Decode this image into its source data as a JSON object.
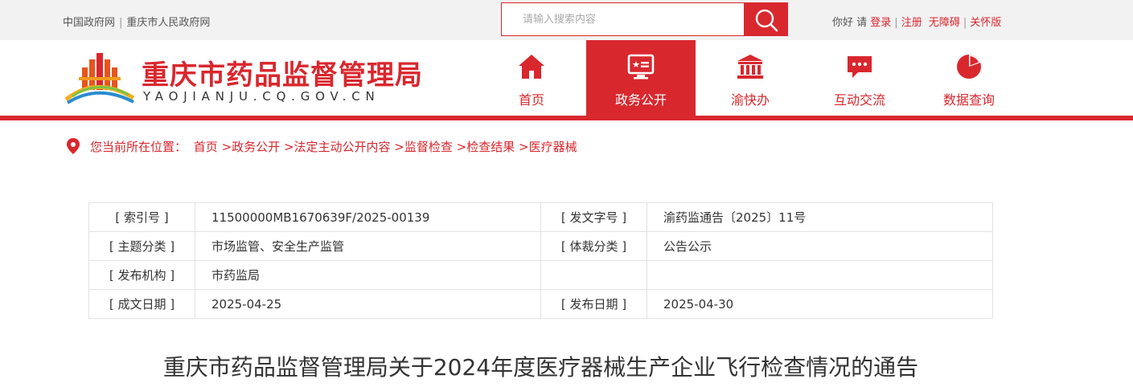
{
  "topbar": {
    "links": [
      "中国政府网",
      "重庆市人民政府网"
    ],
    "search_placeholder": "请输入搜索内容",
    "greeting": "你好 请",
    "login": "登录",
    "register": "注册",
    "accessible": "无障碍",
    "elder_mode": "关怀版"
  },
  "header": {
    "title": "重庆市药品监督管理局",
    "domain": "YAOJIANJU.CQ.GOV.CN",
    "nav": [
      {
        "label": "首页",
        "icon": "home-icon",
        "active": false
      },
      {
        "label": "政务公开",
        "icon": "monitor-star-icon",
        "active": true
      },
      {
        "label": "渝快办",
        "icon": "government-building-icon",
        "active": false
      },
      {
        "label": "互动交流",
        "icon": "chat-icon",
        "active": false
      },
      {
        "label": "数据查询",
        "icon": "pie-chart-icon",
        "active": false
      }
    ]
  },
  "colors": {
    "brand_red": "#d9272e",
    "topbar_bg": "#f2f2f2",
    "border": "#e2e2e2"
  },
  "breadcrumb": {
    "prefix": "您当前所在位置：",
    "items": [
      "首页",
      "政务公开",
      "法定主动公开内容",
      "监督检查",
      "检查结果",
      "医疗器械"
    ]
  },
  "meta": {
    "rows": [
      {
        "k1": "[ 索引号 ]",
        "v1": "11500000MB1670639F/2025-00139",
        "k2": "[ 发文字号 ]",
        "v2": "渝药监通告〔2025〕11号"
      },
      {
        "k1": "[ 主题分类 ]",
        "v1": "市场监管、安全生产监管",
        "k2": "[ 体裁分类 ]",
        "v2": "公告公示"
      },
      {
        "k1": "[ 发布机构 ]",
        "v1": "市药监局",
        "k2": "",
        "v2": ""
      },
      {
        "k1": "[ 成文日期 ]",
        "v1": "2025-04-25",
        "k2": "[ 发布日期 ]",
        "v2": "2025-04-30"
      }
    ]
  },
  "document": {
    "title": "重庆市药品监督管理局关于2024年度医疗器械生产企业飞行检查情况的通告"
  }
}
